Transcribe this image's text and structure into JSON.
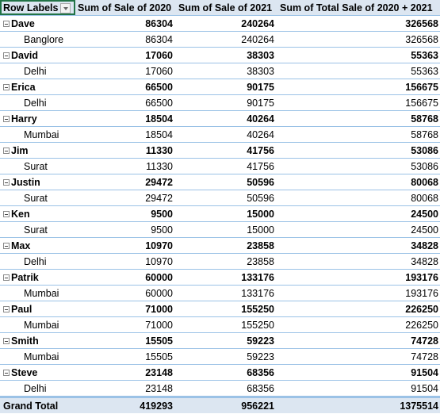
{
  "header": {
    "row_labels": "Row Labels",
    "col1": "Sum of Sale of 2020",
    "col2": "Sum of Sale of 2021",
    "col3": "Sum of Total Sale of 2020 + 2021"
  },
  "groups": [
    {
      "name": "Dave",
      "s2020": "86304",
      "s2021": "240264",
      "total": "326568",
      "city": "Banglore"
    },
    {
      "name": "David",
      "s2020": "17060",
      "s2021": "38303",
      "total": "55363",
      "city": "Delhi"
    },
    {
      "name": "Erica",
      "s2020": "66500",
      "s2021": "90175",
      "total": "156675",
      "city": "Delhi"
    },
    {
      "name": "Harry",
      "s2020": "18504",
      "s2021": "40264",
      "total": "58768",
      "city": "Mumbai"
    },
    {
      "name": "Jim",
      "s2020": "11330",
      "s2021": "41756",
      "total": "53086",
      "city": "Surat"
    },
    {
      "name": "Justin",
      "s2020": "29472",
      "s2021": "50596",
      "total": "80068",
      "city": "Surat"
    },
    {
      "name": "Ken",
      "s2020": "9500",
      "s2021": "15000",
      "total": "24500",
      "city": "Surat"
    },
    {
      "name": "Max",
      "s2020": "10970",
      "s2021": "23858",
      "total": "34828",
      "city": "Delhi"
    },
    {
      "name": "Patrik",
      "s2020": "60000",
      "s2021": "133176",
      "total": "193176",
      "city": "Mumbai"
    },
    {
      "name": "Paul",
      "s2020": "71000",
      "s2021": "155250",
      "total": "226250",
      "city": "Mumbai"
    },
    {
      "name": "Smith",
      "s2020": "15505",
      "s2021": "59223",
      "total": "74728",
      "city": "Mumbai"
    },
    {
      "name": "Steve",
      "s2020": "23148",
      "s2021": "68356",
      "total": "91504",
      "city": "Delhi"
    }
  ],
  "grand_total": {
    "label": "Grand Total",
    "s2020": "419293",
    "s2021": "956221",
    "total": "1375514"
  }
}
